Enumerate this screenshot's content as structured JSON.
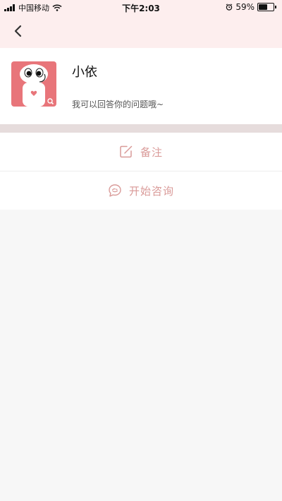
{
  "status_bar": {
    "carrier": "中国移动",
    "time": "下午2:03",
    "battery_percent": "59%",
    "battery_level": 0.59,
    "icons": [
      "signal-icon",
      "wifi-icon",
      "alarm-icon",
      "battery-icon"
    ]
  },
  "nav": {
    "back_icon": "chevron-left-icon"
  },
  "profile": {
    "name": "小依",
    "description": "我可以回答你的问题哦~",
    "avatar_icon": "robot-avatar-icon"
  },
  "actions": [
    {
      "label": "备注",
      "icon": "edit-note-icon"
    },
    {
      "label": "开始咨询",
      "icon": "chat-bubble-icon"
    }
  ],
  "colors": {
    "header_bg": "#fdeeee",
    "accent": "#d99a98",
    "divider_band": "#e6dcdc",
    "avatar_bg": "#e8757a"
  }
}
